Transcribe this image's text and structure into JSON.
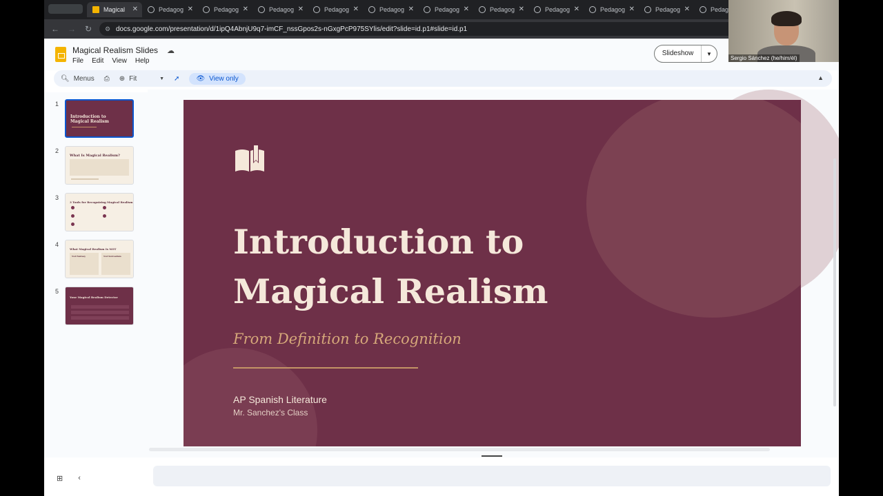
{
  "browser": {
    "active_tab": "Magical",
    "tabs": [
      "Pedagog",
      "Pedagog",
      "Pedagog",
      "Pedagog",
      "Pedagog",
      "Pedagog",
      "Pedagog",
      "Pedagog",
      "Pedagog",
      "Pedagog",
      "Pedago"
    ],
    "url": "docs.google.com/presentation/d/1ipQ4AbnjU9q7-imCF_nssGpos2s-nGxgPcP975SYlis/edit?slide=id.p1#slide=id.p1"
  },
  "doc": {
    "title": "Magical Realism Slides",
    "menus": [
      "File",
      "Edit",
      "View",
      "Help"
    ],
    "slideshow_label": "Slideshow"
  },
  "toolbar": {
    "menus_label": "Menus",
    "zoom_label": "Fit",
    "view_only_label": "View only"
  },
  "filmstrip": {
    "numbers": [
      "1",
      "2",
      "3",
      "4",
      "5"
    ],
    "thumb_titles": [
      "Introduction to Magical Realism",
      "What Is Magical Realism?",
      "3 Tools for Recognizing Magical Realism",
      "What Magical Realism Is NOT",
      "Your Magical Realism Detector"
    ],
    "thumb4_cols": [
      "Not Fantasy",
      "Not Surrealism"
    ]
  },
  "slide": {
    "title_line1": "Introduction to",
    "title_line2": "Magical Realism",
    "subtitle": "From Definition to Recognition",
    "course": "AP Spanish Literature",
    "teacher": "Mr. Sanchez's Class"
  },
  "webcam": {
    "name": "Sergio Sánchez (he/him/él)"
  },
  "colors": {
    "slide_bg": "#6e3048",
    "title_color": "#f5e8da",
    "accent_gold": "#d6a87a"
  }
}
